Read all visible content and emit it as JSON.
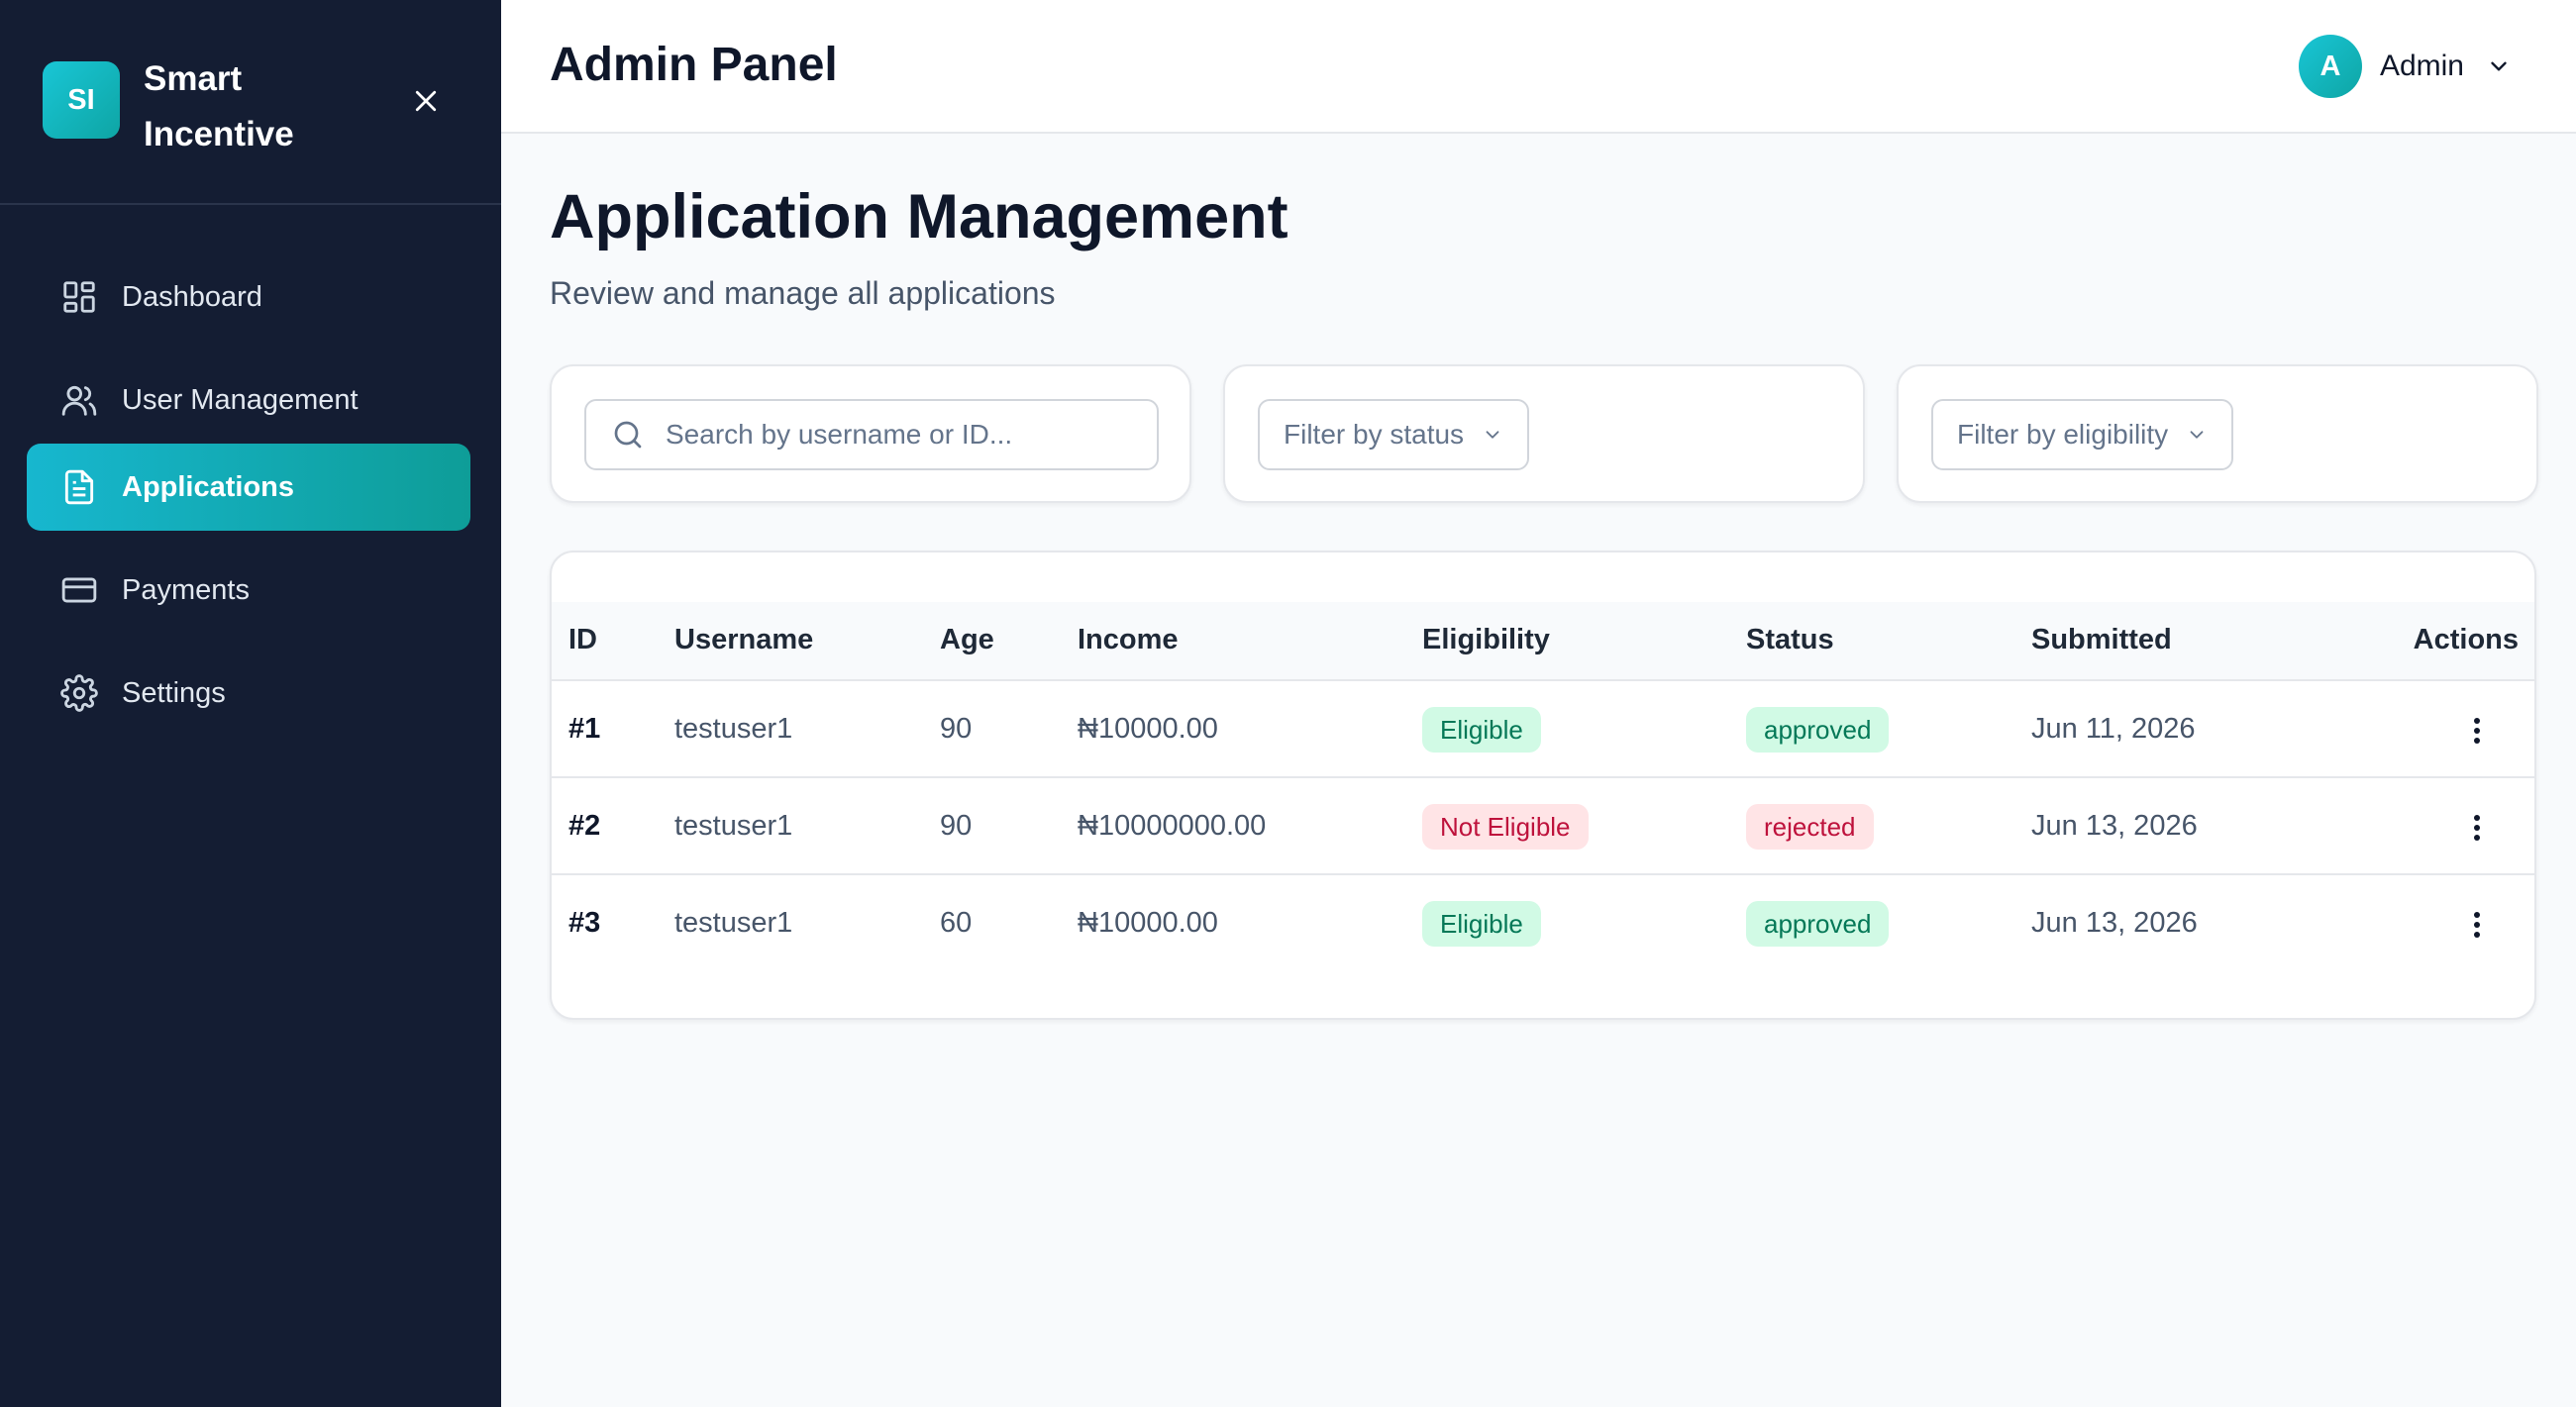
{
  "brand": {
    "logo_text": "SI",
    "name": "Smart Incentive"
  },
  "sidebar": {
    "items": [
      {
        "label": "Dashboard",
        "icon": "dashboard-icon",
        "active": false
      },
      {
        "label": "User Management",
        "icon": "users-icon",
        "active": false
      },
      {
        "label": "Applications",
        "icon": "document-icon",
        "active": true
      },
      {
        "label": "Payments",
        "icon": "credit-card-icon",
        "active": false
      },
      {
        "label": "Settings",
        "icon": "gear-icon",
        "active": false
      }
    ]
  },
  "header": {
    "title": "Admin Panel",
    "user_initial": "A",
    "user_name": "Admin"
  },
  "page": {
    "title": "Application Management",
    "subtitle": "Review and manage all applications"
  },
  "filters": {
    "search_placeholder": "Search by username or ID...",
    "status_label": "Filter by status",
    "eligibility_label": "Filter by eligibility"
  },
  "table": {
    "columns": [
      "ID",
      "Username",
      "Age",
      "Income",
      "Eligibility",
      "Status",
      "Submitted",
      "Actions"
    ],
    "rows": [
      {
        "id": "#1",
        "username": "testuser1",
        "age": "90",
        "income": "₦10000.00",
        "eligibility": "Eligible",
        "status": "approved",
        "submitted": "Jun 11, 2026"
      },
      {
        "id": "#2",
        "username": "testuser1",
        "age": "90",
        "income": "₦10000000.00",
        "eligibility": "Not Eligible",
        "status": "rejected",
        "submitted": "Jun 13, 2026"
      },
      {
        "id": "#3",
        "username": "testuser1",
        "age": "60",
        "income": "₦10000.00",
        "eligibility": "Eligible",
        "status": "approved",
        "submitted": "Jun 13, 2026"
      }
    ]
  },
  "colors": {
    "sidebar_bg": "#141d33",
    "accent": "#17b7cf",
    "badge_good_bg": "#d1fae5",
    "badge_good_text": "#047857",
    "badge_bad_bg": "#ffe4e6",
    "badge_bad_text": "#be123c"
  }
}
